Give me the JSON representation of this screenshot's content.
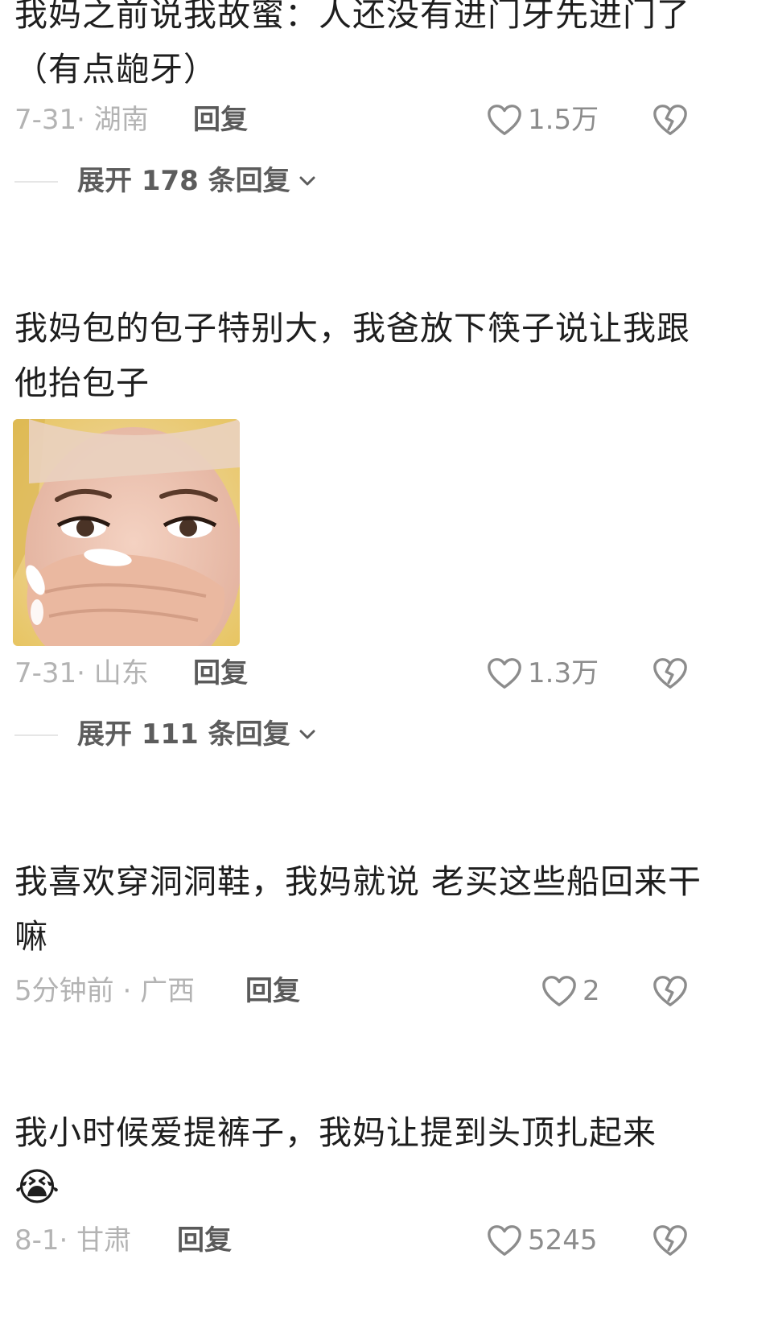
{
  "comments": [
    {
      "text": "我妈之前说我故蜜：人还没有进门牙先进门了（有点龅牙）",
      "date": "7-31",
      "location": "湖南",
      "reply_label": "回复",
      "likes": "1.5万",
      "expand_label": "展开 178 条回复"
    },
    {
      "username": "",
      "text": "我妈包的包子特别大，我爸放下筷子说让我跟他抬包子",
      "image_desc_icon": "photo",
      "date": "7-31",
      "location": "山东",
      "reply_label": "回复",
      "likes": "1.3万",
      "expand_label": "展开 111 条回复"
    },
    {
      "username": "",
      "text": "我喜欢穿洞洞鞋，我妈就说 老买这些船回来干嘛",
      "date": "5分钟前",
      "location": "广西",
      "reply_label": "回复",
      "likes": "2"
    },
    {
      "username": "",
      "text": "我小时候爱提裤子，我妈让提到头顶扎起来",
      "emoji": "😭",
      "date": "8-1",
      "location": "甘肃",
      "reply_label": "回复",
      "likes": "5245"
    }
  ],
  "meta": {
    "separator": "·"
  },
  "colors": {
    "text": "#1e1e1e",
    "meta": "#b3b3b3",
    "reply": "#5a5a5a",
    "icon": "#8c8c8c"
  }
}
